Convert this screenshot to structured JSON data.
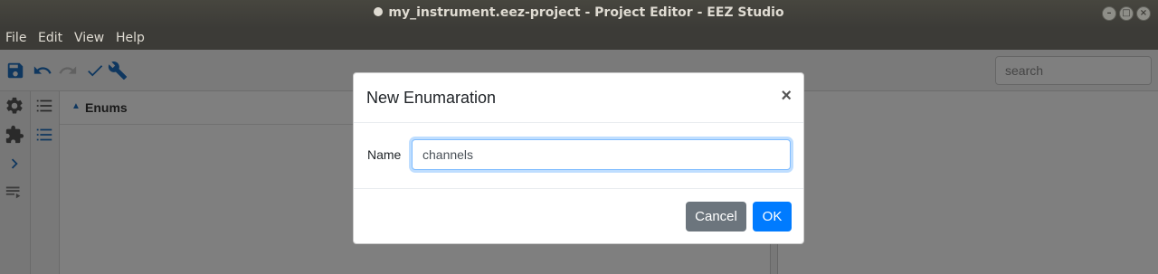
{
  "window": {
    "title": "my_instrument.eez-project - Project Editor - EEZ Studio"
  },
  "menu": {
    "items": [
      "File",
      "Edit",
      "View",
      "Help"
    ]
  },
  "toolbar": {
    "icons": [
      "save-icon",
      "undo-icon",
      "redo-icon",
      "check-icon",
      "wrench-icon"
    ],
    "search_placeholder": "search"
  },
  "sidebar": {
    "icons": [
      "gear-icon",
      "puzzle-icon",
      "chevron-right-icon",
      "playlist-icon"
    ]
  },
  "subnav": {
    "icons": [
      "list-icon",
      "numbered-list-icon"
    ]
  },
  "enums_panel": {
    "title": "Enums",
    "sort_indicator": "▲"
  },
  "dialog": {
    "title": "New Enumaration",
    "close_symbol": "×",
    "name_label": "Name",
    "name_value": "channels",
    "cancel_label": "Cancel",
    "ok_label": "OK"
  },
  "colors": {
    "accent": "#007bff",
    "icon_blue": "#1f6fbf",
    "secondary": "#6c757d"
  }
}
